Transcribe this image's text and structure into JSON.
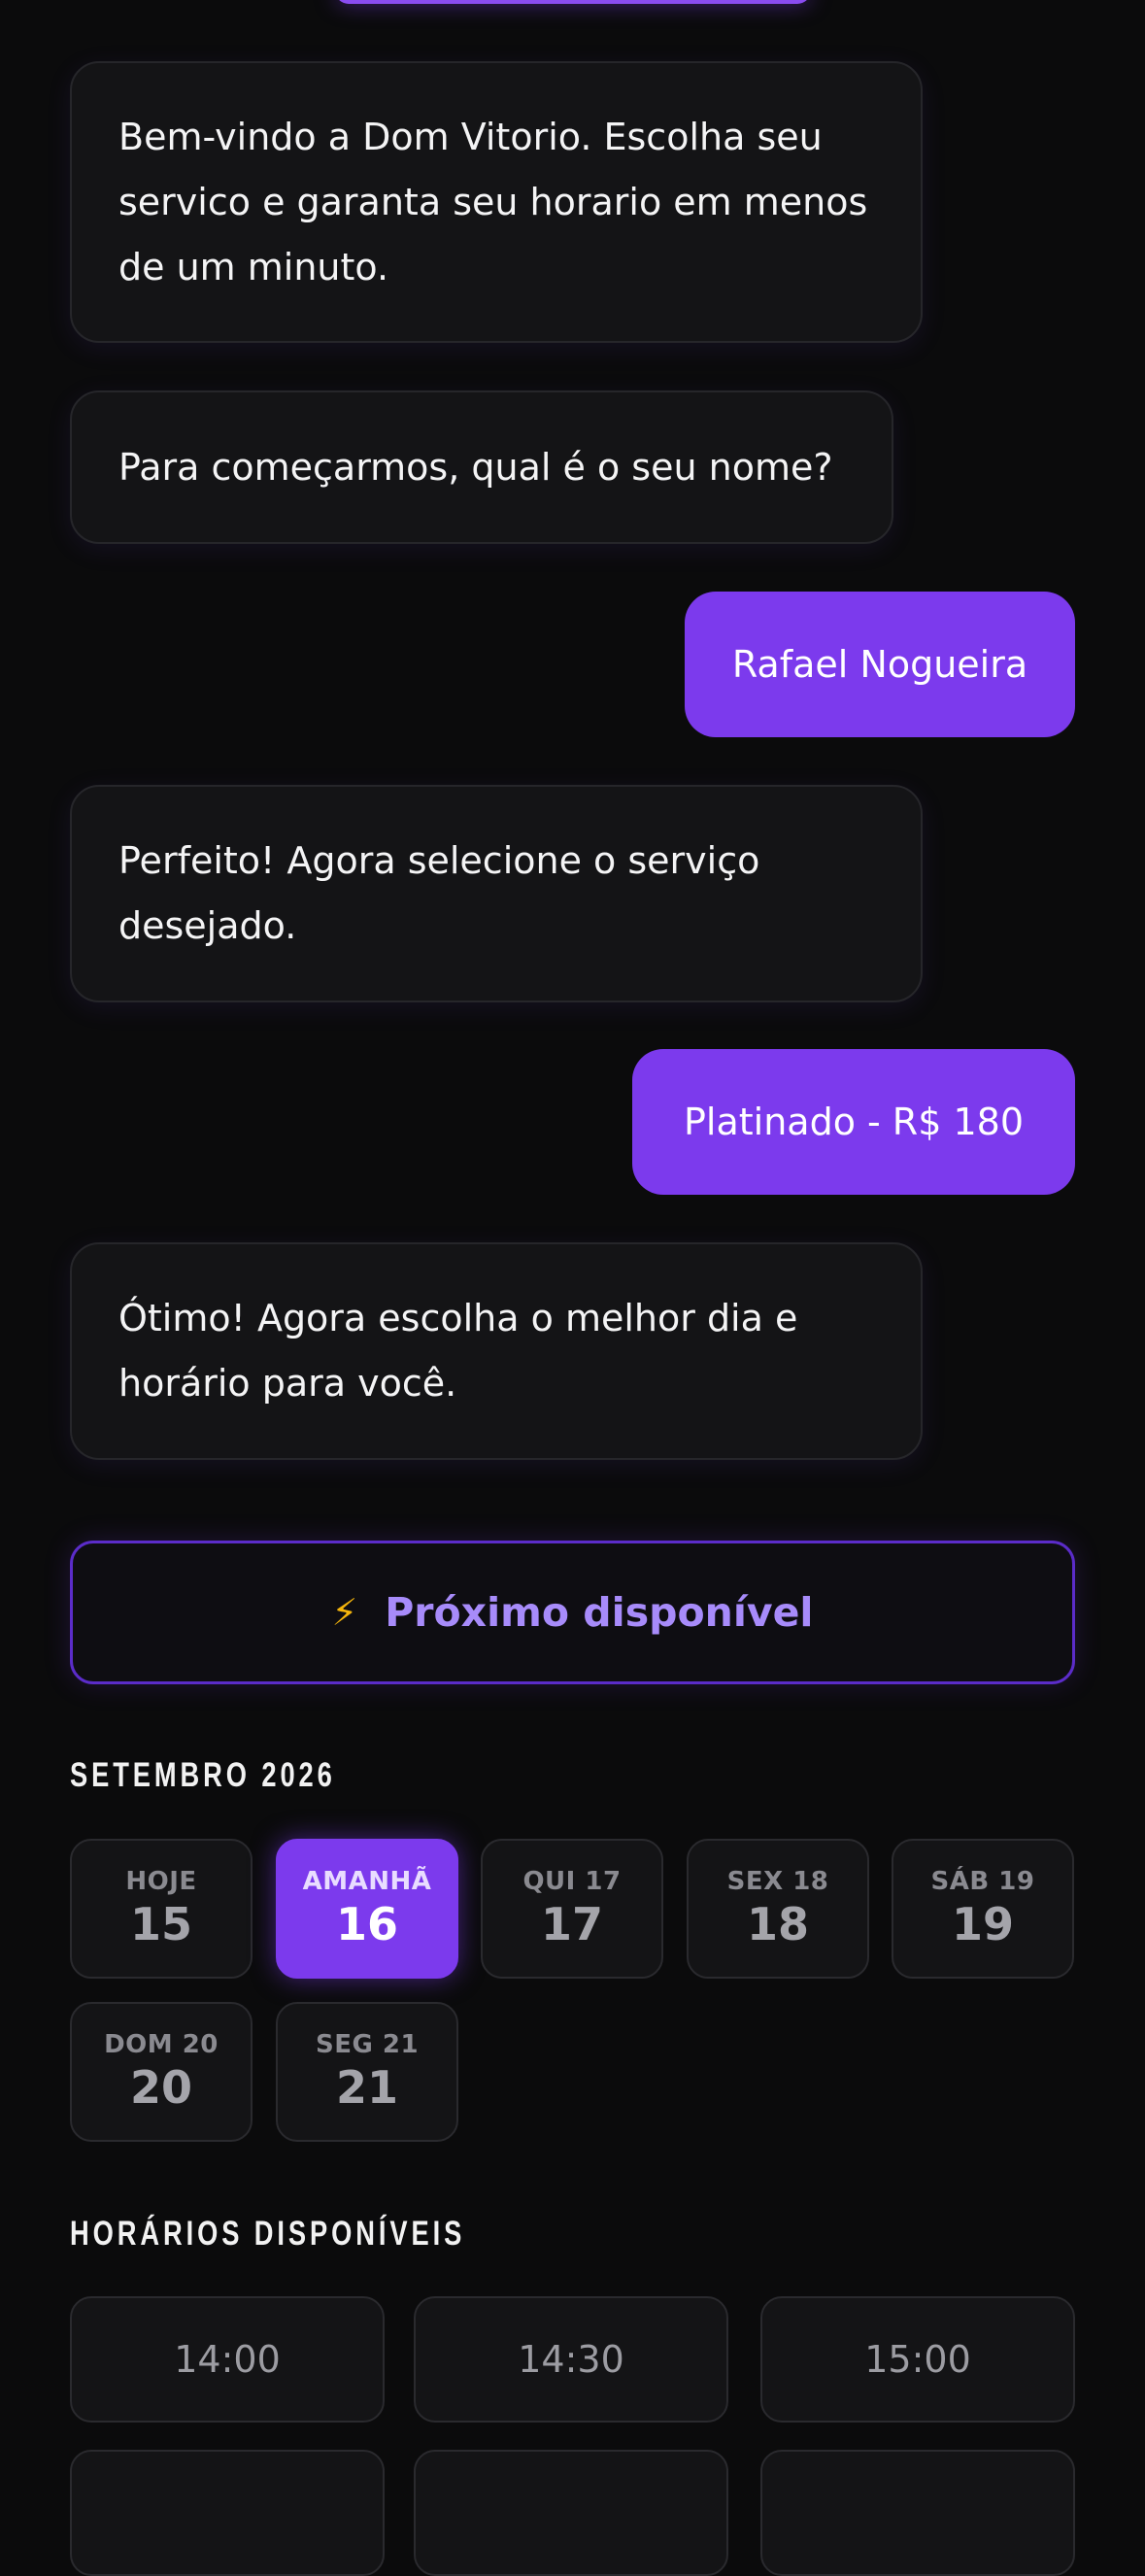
{
  "chat": {
    "messages": [
      {
        "from": "bot",
        "text": "Bem-vindo a Dom Vitorio. Escolha seu servico e garanta seu horario em menos de um minuto."
      },
      {
        "from": "bot",
        "text": "Para começarmos, qual é o seu nome?"
      },
      {
        "from": "user",
        "text": "Rafael Nogueira"
      },
      {
        "from": "bot",
        "text": "Perfeito! Agora selecione o serviço desejado."
      },
      {
        "from": "user",
        "text": "Platinado - R$ 180"
      },
      {
        "from": "bot",
        "text": "Ótimo! Agora escolha o melhor dia e horário para você."
      }
    ]
  },
  "next_available": {
    "icon": "lightning-icon",
    "label": "Próximo disponível"
  },
  "calendar": {
    "month_label": "SETEMBRO 2026",
    "selected_index": 1,
    "days": [
      {
        "label": "HOJE",
        "num": "15"
      },
      {
        "label": "AMANHÃ",
        "num": "16"
      },
      {
        "label": "QUI 17",
        "num": "17"
      },
      {
        "label": "SEX 18",
        "num": "18"
      },
      {
        "label": "SÁB 19",
        "num": "19"
      },
      {
        "label": "DOM 20",
        "num": "20"
      },
      {
        "label": "SEG 21",
        "num": "21"
      }
    ]
  },
  "times": {
    "title": "HORÁRIOS DISPONÍVEIS",
    "slots": [
      "14:00",
      "14:30",
      "15:00"
    ]
  },
  "colors": {
    "accent": "#7c3aed",
    "accent_text": "#a78bfa",
    "bolt": "#f5b50c",
    "background": "#0b0b0c"
  }
}
